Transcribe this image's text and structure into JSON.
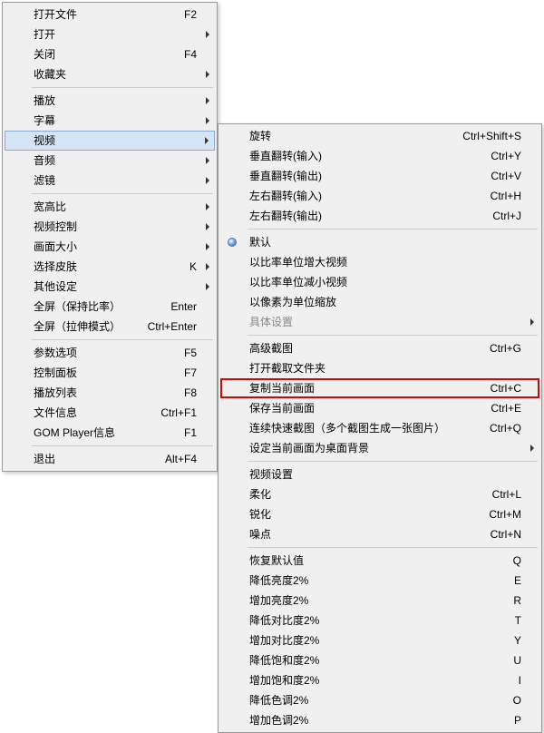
{
  "mainMenu": {
    "items": [
      {
        "label": "打开文件",
        "shortcut": "F2"
      },
      {
        "label": "打开",
        "submenu": true
      },
      {
        "label": "关闭",
        "shortcut": "F4"
      },
      {
        "label": "收藏夹",
        "submenu": true
      },
      {
        "sep": true
      },
      {
        "label": "播放",
        "submenu": true
      },
      {
        "label": "字幕",
        "submenu": true
      },
      {
        "label": "视频",
        "submenu": true,
        "hovered": true
      },
      {
        "label": "音频",
        "submenu": true
      },
      {
        "label": "滤镜",
        "submenu": true
      },
      {
        "sep": true
      },
      {
        "label": "宽高比",
        "submenu": true
      },
      {
        "label": "视频控制",
        "submenu": true
      },
      {
        "label": "画面大小",
        "submenu": true
      },
      {
        "label": "选择皮肤",
        "shortcut": "K",
        "submenu": true
      },
      {
        "label": "其他设定",
        "submenu": true
      },
      {
        "label": "全屏（保持比率）",
        "shortcut": "Enter"
      },
      {
        "label": "全屏（拉伸模式）",
        "shortcut": "Ctrl+Enter"
      },
      {
        "sep": true
      },
      {
        "label": "参数选项",
        "shortcut": "F5"
      },
      {
        "label": "控制面板",
        "shortcut": "F7"
      },
      {
        "label": "播放列表",
        "shortcut": "F8"
      },
      {
        "label": "文件信息",
        "shortcut": "Ctrl+F1"
      },
      {
        "label": "GOM Player信息",
        "shortcut": "F1"
      },
      {
        "sep": true
      },
      {
        "label": "退出",
        "shortcut": "Alt+F4"
      }
    ]
  },
  "subMenu": {
    "items": [
      {
        "label": "旋转",
        "shortcut": "Ctrl+Shift+S"
      },
      {
        "label": "垂直翻转(输入)",
        "shortcut": "Ctrl+Y"
      },
      {
        "label": "垂直翻转(输出)",
        "shortcut": "Ctrl+V"
      },
      {
        "label": "左右翻转(输入)",
        "shortcut": "Ctrl+H"
      },
      {
        "label": "左右翻转(输出)",
        "shortcut": "Ctrl+J"
      },
      {
        "sep": true
      },
      {
        "label": "默认",
        "bullet": true
      },
      {
        "label": "以比率单位增大视频"
      },
      {
        "label": "以比率单位减小视频"
      },
      {
        "label": "以像素为单位缩放"
      },
      {
        "label": "具体设置",
        "submenu": true,
        "disabled": true
      },
      {
        "sep": true
      },
      {
        "label": "高级截图",
        "shortcut": "Ctrl+G"
      },
      {
        "label": "打开截取文件夹"
      },
      {
        "label": "复制当前画面",
        "shortcut": "Ctrl+C",
        "highlighted": true
      },
      {
        "label": "保存当前画面",
        "shortcut": "Ctrl+E"
      },
      {
        "label": "连续快速截图（多个截图生成一张图片）",
        "shortcut": "Ctrl+Q"
      },
      {
        "label": "设定当前画面为桌面背景",
        "submenu": true
      },
      {
        "sep": true
      },
      {
        "label": "视频设置"
      },
      {
        "label": "柔化",
        "shortcut": "Ctrl+L"
      },
      {
        "label": "锐化",
        "shortcut": "Ctrl+M"
      },
      {
        "label": "噪点",
        "shortcut": "Ctrl+N"
      },
      {
        "sep": true
      },
      {
        "label": "恢复默认值",
        "shortcut": "Q"
      },
      {
        "label": "降低亮度2%",
        "shortcut": "E"
      },
      {
        "label": "增加亮度2%",
        "shortcut": "R"
      },
      {
        "label": "降低对比度2%",
        "shortcut": "T"
      },
      {
        "label": "增加对比度2%",
        "shortcut": "Y"
      },
      {
        "label": "降低饱和度2%",
        "shortcut": "U"
      },
      {
        "label": "增加饱和度2%",
        "shortcut": "I"
      },
      {
        "label": "降低色调2%",
        "shortcut": "O"
      },
      {
        "label": "增加色调2%",
        "shortcut": "P"
      }
    ]
  }
}
